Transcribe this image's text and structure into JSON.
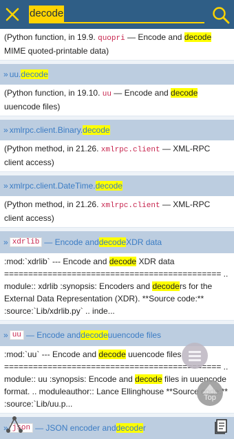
{
  "header": {
    "query": "decode"
  },
  "results": [
    {
      "type": "body",
      "parts": [
        {
          "t": "(Python function, in 19.9. "
        },
        {
          "t": "quopri",
          "s": "mono"
        },
        {
          "t": " — Encode and "
        },
        {
          "t": "decode",
          "s": "hl"
        },
        {
          "t": " MIME quoted-printable data)"
        }
      ]
    },
    {
      "type": "header",
      "parts": [
        {
          "t": "» ",
          "s": "arrow"
        },
        {
          "t": "uu."
        },
        {
          "t": "decode",
          "s": "hl"
        }
      ]
    },
    {
      "type": "body",
      "parts": [
        {
          "t": "(Python function, in 19.10. "
        },
        {
          "t": "uu",
          "s": "mono"
        },
        {
          "t": " — Encode and "
        },
        {
          "t": "decode",
          "s": "hl"
        },
        {
          "t": " uuencode files)"
        }
      ]
    },
    {
      "type": "header",
      "parts": [
        {
          "t": "» ",
          "s": "arrow"
        },
        {
          "t": "xmlrpc.client.Binary."
        },
        {
          "t": "decode",
          "s": "hl"
        }
      ]
    },
    {
      "type": "body",
      "parts": [
        {
          "t": "(Python method, in 21.26. "
        },
        {
          "t": "xmlrpc.client",
          "s": "mono"
        },
        {
          "t": " — XML-RPC client access)"
        }
      ]
    },
    {
      "type": "header",
      "parts": [
        {
          "t": "» ",
          "s": "arrow"
        },
        {
          "t": "xmlrpc.client.DateTime."
        },
        {
          "t": "decode",
          "s": "hl"
        }
      ]
    },
    {
      "type": "body",
      "parts": [
        {
          "t": "(Python method, in 21.26. "
        },
        {
          "t": "xmlrpc.client",
          "s": "mono"
        },
        {
          "t": " — XML-RPC client access)"
        }
      ]
    },
    {
      "type": "header",
      "tall": true,
      "parts": [
        {
          "t": "» ",
          "s": "arrow"
        },
        {
          "t": "xdrlib",
          "s": "code"
        },
        {
          "t": " — Encode and "
        },
        {
          "t": "decode",
          "s": "hl"
        },
        {
          "t": " XDR data"
        }
      ]
    },
    {
      "type": "body",
      "parts": [
        {
          "t": ":mod:`xdrlib` --- Encode and "
        },
        {
          "t": "decode",
          "s": "hl"
        },
        {
          "t": " XDR data ============================================= .. module:: xdrlib :synopsis: Encoders and "
        },
        {
          "t": "decode",
          "s": "hl"
        },
        {
          "t": "rs for the External Data Representation (XDR). **Source code:** :source:`Lib/xdrlib.py` .. inde..."
        }
      ]
    },
    {
      "type": "header",
      "tall": true,
      "parts": [
        {
          "t": "» ",
          "s": "arrow"
        },
        {
          "t": "uu",
          "s": "code"
        },
        {
          "t": " — Encode and "
        },
        {
          "t": "decode",
          "s": "hl"
        },
        {
          "t": " uuencode files"
        }
      ]
    },
    {
      "type": "body",
      "parts": [
        {
          "t": ":mod:`uu` --- Encode and "
        },
        {
          "t": "decode",
          "s": "hl"
        },
        {
          "t": " uuencode files ============================================= .. module:: uu :synopsis: Encode and "
        },
        {
          "t": "decode",
          "s": "hl"
        },
        {
          "t": " files in uuencode format. .. moduleauthor:: Lance Ellinghouse **Source code:** :source:`Lib/uu.p..."
        }
      ]
    },
    {
      "type": "header",
      "tall": true,
      "parts": [
        {
          "t": "» ",
          "s": "arrow"
        },
        {
          "t": "json",
          "s": "code"
        },
        {
          "t": " — JSON encoder and "
        },
        {
          "t": "decode",
          "s": "hl"
        },
        {
          "t": "r"
        }
      ]
    }
  ],
  "fab": {
    "top_label": "Top"
  },
  "icons": {
    "close": "close-icon",
    "search": "search-icon",
    "menu": "menu-icon",
    "top": "arrow-up-icon",
    "share": "share-icon",
    "book": "book-icon"
  },
  "colors": {
    "topbar": "#2f5e86",
    "highlight": "#ffff00",
    "query_highlight": "#ffd400",
    "header_bg": "#bccde0",
    "link": "#3b7cc4",
    "code": "#c7254e"
  }
}
